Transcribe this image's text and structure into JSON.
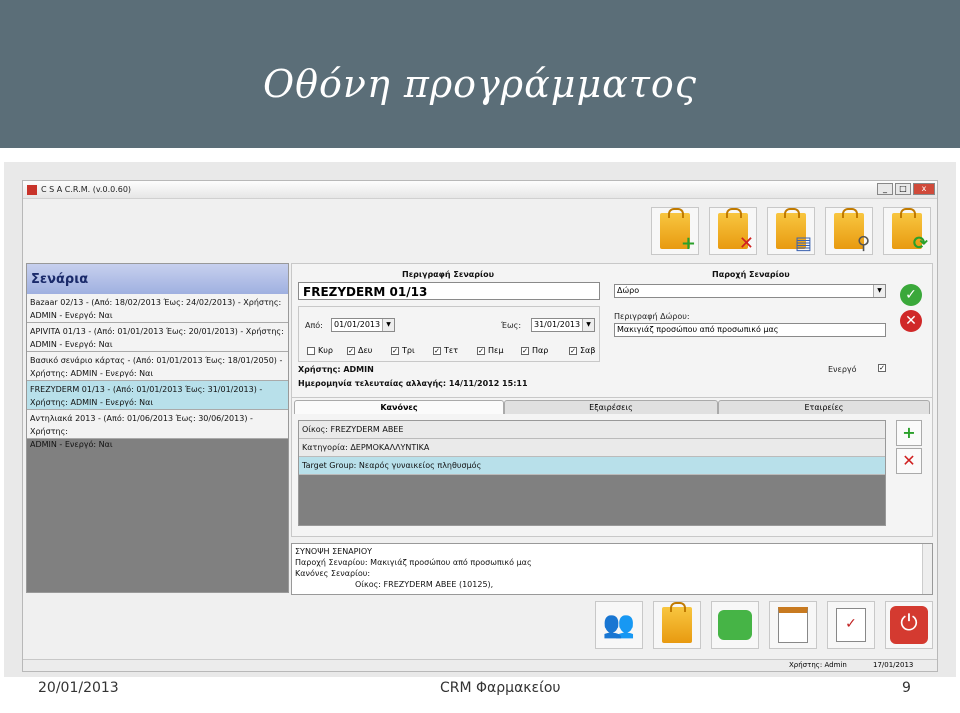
{
  "slide": {
    "title": "Οθόνη προγράμματος",
    "footer_date": "20/01/2013",
    "footer_center": "CRM Φαρμακείου",
    "page_number": "9"
  },
  "window": {
    "title": "C S A C.R.M.  (v.0.0.60)",
    "min": "_",
    "max": "□",
    "close": "x"
  },
  "toolbar_top": [
    {
      "icon": "add-scenario-icon",
      "badge": "+"
    },
    {
      "icon": "delete-scenario-icon",
      "badge": "✕"
    },
    {
      "icon": "copy-scenario-icon",
      "badge": "▤"
    },
    {
      "icon": "search-scenario-icon",
      "badge": "⚲"
    },
    {
      "icon": "refresh-scenario-icon",
      "badge": "⟳"
    }
  ],
  "scenarios": {
    "header": "Σενάρια",
    "items": [
      {
        "line1": "Bazaar 02/13 - (Από: 18/02/2013 Έως: 24/02/2013) - Χρήστης:",
        "line2": "ADMIN - Ενεργό: Ναι"
      },
      {
        "line1": "APIVITA 01/13 - (Από: 01/01/2013 Έως: 20/01/2013) - Χρήστης:",
        "line2": "ADMIN - Ενεργό: Ναι"
      },
      {
        "line1": "Βασικό σενάριο κάρτας - (Από: 01/01/2013 Έως: 18/01/2050) -",
        "line2": "Χρήστης: ADMIN - Ενεργό: Ναι"
      },
      {
        "line1": "FREZYDERM 01/13 - (Από: 01/01/2013 Έως: 31/01/2013) -",
        "line2": "Χρήστης: ADMIN - Ενεργό: Ναι"
      },
      {
        "line1": "Αντηλιακά 2013 - (Από: 01/06/2013 Έως: 30/06/2013) - Χρήστης:",
        "line2": "ADMIN - Ενεργό: Ναι"
      }
    ]
  },
  "description": {
    "header": "Περιγραφή Σεναρίου",
    "name": "FREZYDERM 01/13",
    "from_label": "Από:",
    "from_value": "01/01/2013",
    "to_label": "Έως:",
    "to_value": "31/01/2013",
    "days": [
      {
        "label": "Κυρ",
        "checked": ""
      },
      {
        "label": "Δευ",
        "checked": "✓"
      },
      {
        "label": "Τρι",
        "checked": "✓"
      },
      {
        "label": "Τετ",
        "checked": "✓"
      },
      {
        "label": "Πεμ",
        "checked": "✓"
      },
      {
        "label": "Παρ",
        "checked": "✓"
      },
      {
        "label": "Σαβ",
        "checked": "✓"
      }
    ],
    "user": "Χρήστης: ADMIN",
    "last_change": "Ημερομηνία τελευταίας αλλαγής: 14/11/2012 15:11"
  },
  "provision": {
    "header": "Παροχή Σεναρίου",
    "type_value": "Δώρο",
    "gift_label": "Περιγραφή Δώρου:",
    "gift_value": "Μακιγιάζ προσώπου από προσωπικό μας",
    "active_label": "Ενεργό",
    "active_checked": "✓",
    "ok": "✓",
    "cancel": "✕"
  },
  "tabs": [
    "Κανόνες",
    "Εξαιρέσεις",
    "Εταιρείες"
  ],
  "rules": [
    "Οίκος: FREZYDERM ABEE",
    "Κατηγορία: ΔΕΡΜΟΚΑΛΛΥΝΤΙΚΑ",
    "Target Group: Νεαρός γυναικείος πληθυσμός"
  ],
  "summary": {
    "line1": "ΣΥΝΟΨΗ ΣΕΝΑΡΙΟΥ",
    "line2": "Παροχή Σεναρίου: Μακιγιάζ προσώπου από προσωπικό μας",
    "line3": "Κανόνες Σεναρίου:",
    "line4": "Οίκος: FREZYDERM ABEE (10125),"
  },
  "status": {
    "user": "Χρήστης: Admin",
    "date": "17/01/2013"
  },
  "colors": {
    "slide_header": "#5b6e78",
    "selected_row": "#b8e0ea",
    "list_header": "#9fb0e0"
  }
}
